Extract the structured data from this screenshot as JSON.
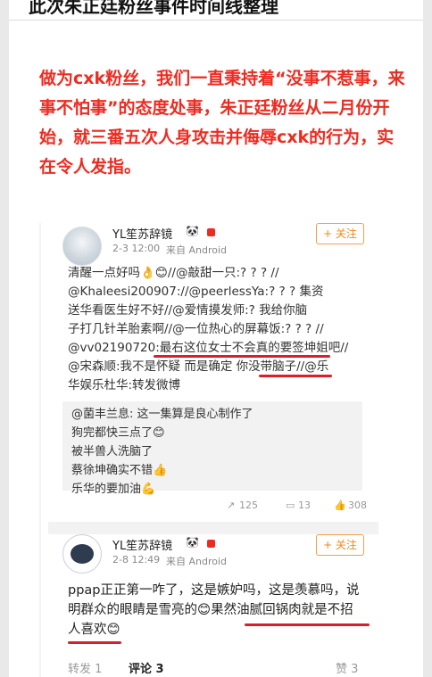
{
  "page_title": "此次朱正廷粉丝事件时间线整理",
  "statement": "做为cxk粉丝，我们一直秉持着“没事不惹事，来事不怕事”的态度处事，朱正廷粉丝从二月份开始，就三番五次人身攻击并侮辱cxk的行为，实在令人发指。",
  "post1": {
    "username": "YL笙苏辞镜",
    "time": "2-3 12:00",
    "source": "来自 Android",
    "follow_label": "+ 关注",
    "lines": [
      "清醒一点好吗👌😊//@敲甜一只:? ? ? //",
      "@Khaleesi200907://@peerlessYa:? ? ? 集资",
      "送华看医生好不好//@爱情摸发师:? 我给你脑",
      "子打几针羊胎素啊//@一位热心的屏幕饭:? ? ? //",
      "@vv02190720:最右这位女士不会真的要签坤姐吧//",
      "@宋森顺:我不是怀疑 而是确定 你没带脑子//@乐",
      "华娱乐杜华:转发微博"
    ],
    "repost_lines": [
      "@菌丰兰息: 这一集算是良心制作了",
      "狗完都快三点了😊",
      "被半兽人洗脑了",
      "蔡徐坤确实不错👍",
      "乐华的要加油💪"
    ],
    "counts": {
      "repost": "125",
      "comment": "13",
      "like": "308"
    }
  },
  "post2": {
    "username": "YL笙苏辞镜",
    "time": "2-8 12:49",
    "source": "来自 Android",
    "follow_label": "+ 关注",
    "lines": [
      "ppap正正第一咋了，这是嫉妒吗，这是羡慕吗，说",
      "明群众的眼睛是雪亮的😊果然油腻回锅肉就是不招",
      "人喜欢😊"
    ]
  },
  "bottom_bar": {
    "repost": "转发 1",
    "comment": "评论 3",
    "like": "赞 3"
  }
}
